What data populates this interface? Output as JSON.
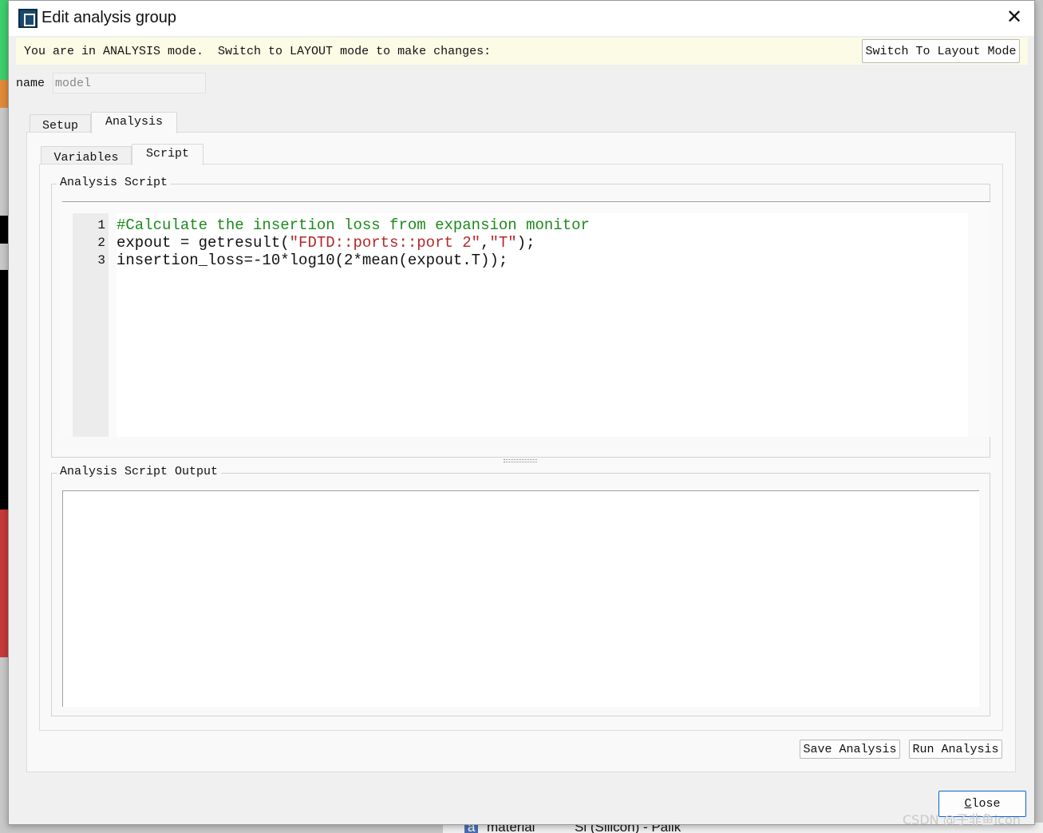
{
  "dialog": {
    "title": "Edit analysis group",
    "close_icon": "close-icon"
  },
  "banner": {
    "text": "You are in ANALYSIS mode.  Switch to LAYOUT mode to make changes:",
    "button": "Switch To Layout Mode"
  },
  "name": {
    "label": "name",
    "value": "model"
  },
  "tabs": [
    {
      "label": "Setup",
      "active": false
    },
    {
      "label": "Analysis",
      "active": true
    }
  ],
  "subtabs": [
    {
      "label": "Variables",
      "active": false
    },
    {
      "label": "Script",
      "active": true
    }
  ],
  "script_group": {
    "label": "Analysis Script",
    "lines": [
      {
        "num": "1",
        "parts": [
          {
            "t": "#Calculate the insertion loss from expansion monitor",
            "c": "cm"
          }
        ]
      },
      {
        "num": "2",
        "parts": [
          {
            "t": "expout = getresult(",
            "c": ""
          },
          {
            "t": "\"FDTD::ports::port 2\"",
            "c": "str"
          },
          {
            "t": ",",
            "c": ""
          },
          {
            "t": "\"T\"",
            "c": "str"
          },
          {
            "t": ");",
            "c": ""
          }
        ]
      },
      {
        "num": "3",
        "parts": [
          {
            "t": "insertion_loss=-10*log10(2*mean(expout.T));",
            "c": ""
          }
        ]
      }
    ]
  },
  "output_group": {
    "label": "Analysis Script Output",
    "text": ""
  },
  "buttons": {
    "save": "Save Analysis",
    "run": "Run Analysis",
    "close": "Close"
  },
  "background": {
    "row_icon": "a",
    "row_label": "material",
    "row_value": "Si (Silicon) - Palik"
  },
  "watermark": "CSDN @子非鱼icon",
  "colors": {
    "comment": "#1c8a1c",
    "string": "#b5272b",
    "banner": "#fbfbe6",
    "close_border": "#0a64c8"
  }
}
